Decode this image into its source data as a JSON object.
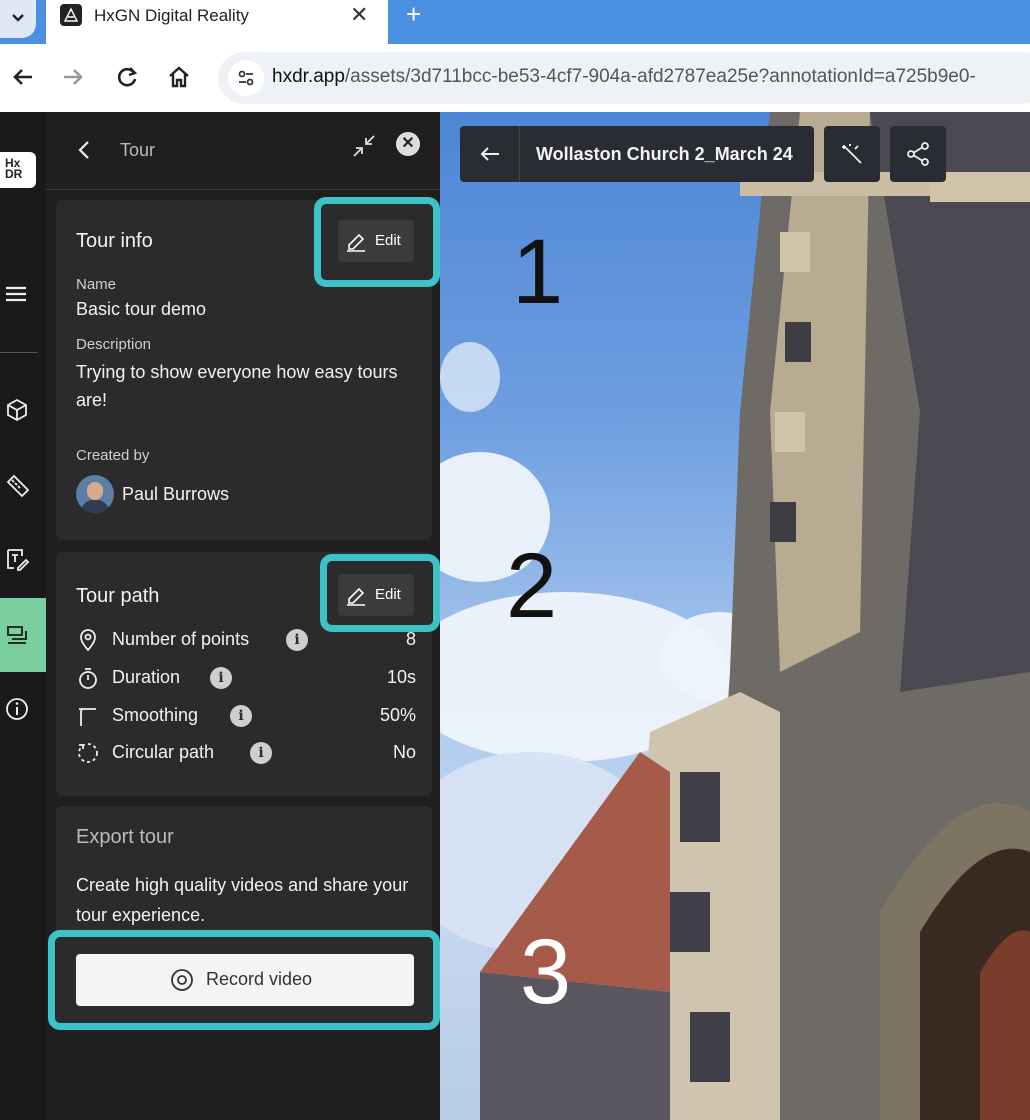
{
  "browser": {
    "tab_title": "HxGN Digital Reality",
    "tab_close": "✕",
    "new_tab": "+",
    "url_host": "hxdr.app",
    "url_path": "/assets/3d711bcc-be53-4cf7-904a-afd2787ea25e?annotationId=a725b9e0-"
  },
  "rail": {
    "logo_line1": "Hx",
    "logo_line2": "DR",
    "icons": [
      "menu-icon",
      "cube-icon",
      "ruler-icon",
      "annotation-icon",
      "tour-icon",
      "info-icon"
    ]
  },
  "panel": {
    "title": "Tour",
    "tour_info": {
      "heading": "Tour info",
      "edit_label": "Edit",
      "name_label": "Name",
      "name_value": "Basic tour demo",
      "description_label": "Description",
      "description_value": "Trying to show everyone how easy tours are!",
      "created_by_label": "Created by",
      "created_by_value": "Paul Burrows"
    },
    "tour_path": {
      "heading": "Tour path",
      "edit_label": "Edit",
      "rows": [
        {
          "label": "Number of points",
          "value": "8",
          "icon": "location-pin-icon"
        },
        {
          "label": "Duration",
          "value": "10s",
          "icon": "stopwatch-icon"
        },
        {
          "label": "Smoothing",
          "value": "50%",
          "icon": "curve-icon"
        },
        {
          "label": "Circular path",
          "value": "No",
          "icon": "circular-path-icon"
        }
      ],
      "info_glyph": "i"
    },
    "export": {
      "heading": "Export tour",
      "description": "Create high quality videos and share your tour experience.",
      "record_label": "Record video"
    }
  },
  "viewer": {
    "asset_title": "Wollaston Church 2_March 24",
    "step_numbers": [
      "1",
      "2",
      "3"
    ]
  },
  "colors": {
    "highlight": "#3cc2c7",
    "rail_active": "#7bcf9e",
    "tabbar": "#4a8fe0"
  }
}
